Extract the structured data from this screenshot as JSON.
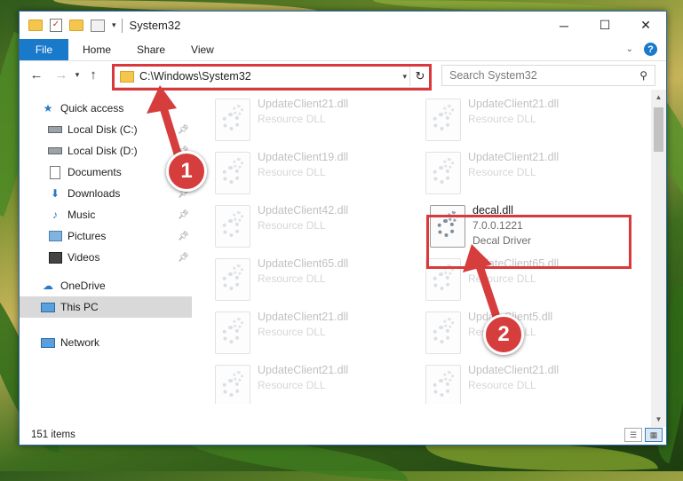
{
  "window": {
    "title": "System32"
  },
  "window_buttons": {
    "minimize": "─",
    "maximize": "☐",
    "close": "✕"
  },
  "ribbon": {
    "tabs": [
      "File",
      "Home",
      "Share",
      "View"
    ],
    "help": "?"
  },
  "address_bar": {
    "path": "C:\\Windows\\System32"
  },
  "search": {
    "placeholder": "Search System32"
  },
  "nav": {
    "quick_access": "Quick access",
    "items": [
      {
        "label": "Local Disk (C:)",
        "icon": "drive-icon",
        "pinned": true
      },
      {
        "label": "Local Disk (D:)",
        "icon": "drive-icon",
        "pinned": true
      },
      {
        "label": "Documents",
        "icon": "documents-icon",
        "pinned": true
      },
      {
        "label": "Downloads",
        "icon": "downloads-icon",
        "pinned": true
      },
      {
        "label": "Music",
        "icon": "music-icon",
        "pinned": true
      },
      {
        "label": "Pictures",
        "icon": "pictures-icon",
        "pinned": true
      },
      {
        "label": "Videos",
        "icon": "videos-icon",
        "pinned": true
      }
    ],
    "onedrive": "OneDrive",
    "this_pc": "This PC",
    "network": "Network"
  },
  "files": [
    {
      "name": "UpdateClient21.dll",
      "line2": "Resource DLL",
      "line3": ""
    },
    {
      "name": "UpdateClient21.dll",
      "line2": "Resource DLL",
      "line3": ""
    },
    {
      "name": "UpdateClient19.dll",
      "line2": "Resource DLL",
      "line3": ""
    },
    {
      "name": "UpdateClient21.dll",
      "line2": "Resource DLL",
      "line3": ""
    },
    {
      "name": "UpdateClient42.dll",
      "line2": "Resource DLL",
      "line3": ""
    },
    {
      "name": "decal.dll",
      "line2": "7.0.0.1221",
      "line3": "Decal Driver"
    },
    {
      "name": "UpdateClient65.dll",
      "line2": "Resource DLL",
      "line3": ""
    },
    {
      "name": "UpdateClient65.dll",
      "line2": "Resource DLL",
      "line3": ""
    },
    {
      "name": "UpdateClient21.dll",
      "line2": "Resource DLL",
      "line3": ""
    },
    {
      "name": "UpdateClient5.dll",
      "line2": "Resource DLL",
      "line3": ""
    },
    {
      "name": "UpdateClient21.dll",
      "line2": "Resource DLL",
      "line3": ""
    },
    {
      "name": "UpdateClient21.dll",
      "line2": "Resource DLL",
      "line3": ""
    }
  ],
  "status": {
    "items_count": "151 items"
  },
  "annotations": {
    "step1": "1",
    "step2": "2"
  },
  "colors": {
    "accent": "#1979ca",
    "highlight": "#d9393c",
    "annotation": "#d63d3d"
  }
}
